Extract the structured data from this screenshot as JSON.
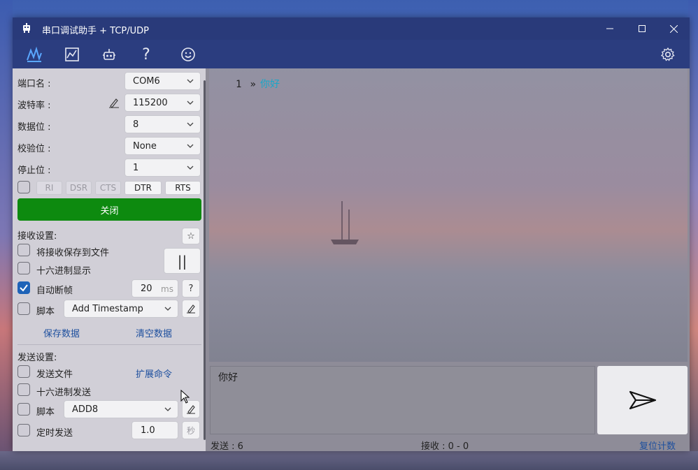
{
  "window": {
    "title": "串口调试助手 + TCP/UDP"
  },
  "toolbar": {
    "icons": [
      "serial-wave-icon",
      "chart-icon",
      "robot-icon",
      "help-icon",
      "smiley-icon",
      "settings-icon"
    ]
  },
  "serial": {
    "port_label": "端口名 :",
    "port_value": "COM6",
    "baud_label": "波特率 :",
    "baud_value": "115200",
    "databits_label": "数据位 :",
    "databits_value": "8",
    "parity_label": "校验位 :",
    "parity_value": "None",
    "stopbits_label": "停止位 :",
    "stopbits_value": "1",
    "signals": [
      "RI",
      "DSR",
      "CTS",
      "DTR",
      "RTS"
    ],
    "close_label": "关闭"
  },
  "receive_settings": {
    "title": "接收设置:",
    "save_to_file": "将接收保存到文件",
    "hex_display": "十六进制显示",
    "auto_frame": "自动断帧",
    "auto_frame_value": "20",
    "auto_frame_unit": "ms",
    "help": "?",
    "script_label": "脚本",
    "script_value": "Add Timestamp",
    "save_data": "保存数据",
    "clear_data": "清空数据"
  },
  "send_settings": {
    "title": "发送设置:",
    "send_file": "发送文件",
    "ext_cmd": "扩展命令",
    "hex_send": "十六进制发送",
    "script_label": "脚本",
    "script_value": "ADD8",
    "timed_send": "定时发送",
    "timed_value": "1.0",
    "timed_unit": "秒"
  },
  "receive": {
    "line_number": "1",
    "arrow": "»",
    "text": "你好"
  },
  "send": {
    "text": "你好"
  },
  "status": {
    "sent": "发送 : 6",
    "received": "接收 : 0 - 0",
    "reset": "复位计数"
  },
  "colors": {
    "accent": "#1d4f9e",
    "close_button": "#0d8a0f",
    "received_text": "#1aa7c9",
    "titlebar": "#293a7a"
  }
}
